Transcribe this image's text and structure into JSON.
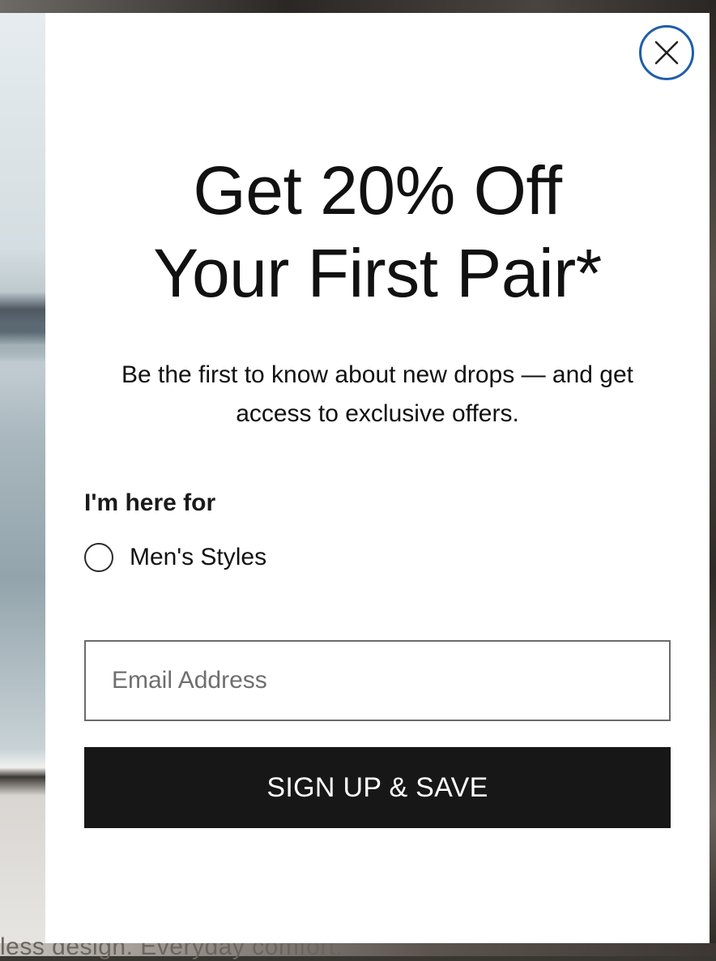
{
  "background": {
    "caption": "less design. Everyday comfort."
  },
  "modal": {
    "close_icon": "close-icon",
    "headline_line1": "Get 20% Off",
    "headline_line2": "Your First Pair*",
    "subtext": "Be the first to know about new drops — and get access to exclusive offers.",
    "form": {
      "label": "I'm here for",
      "options": [
        {
          "label": "Men's Styles",
          "selected": false
        }
      ],
      "email_placeholder": "Email Address",
      "email_value": "",
      "submit_label": "SIGN UP & SAVE"
    }
  },
  "colors": {
    "close_ring": "#1f5fa8",
    "button_bg": "#171717",
    "button_text": "#ffffff",
    "text": "#111111"
  }
}
